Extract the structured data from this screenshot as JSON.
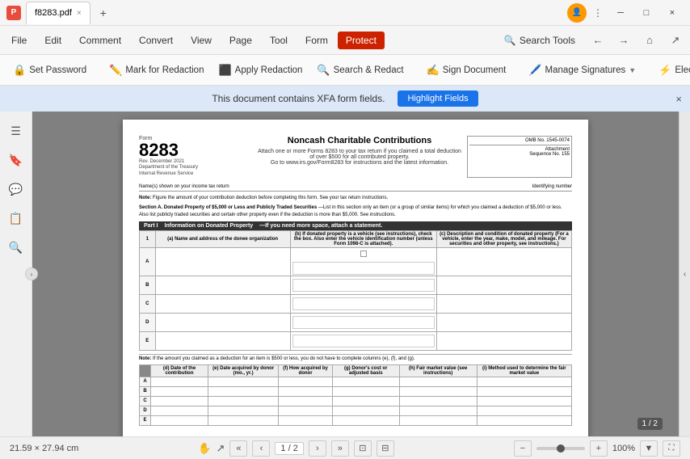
{
  "titlebar": {
    "app_icon": "P",
    "tab_filename": "f8283.pdf",
    "tab_close": "×",
    "tab_add": "+",
    "profile_icon": "👤",
    "window_min": "─",
    "window_max": "□",
    "window_close": "×"
  },
  "menubar": {
    "items": [
      "File",
      "Edit",
      "Comment",
      "Convert",
      "View",
      "Page",
      "Tool",
      "Form",
      "Protect"
    ],
    "active": "Protect",
    "search_tools": "Search Tools",
    "nav_back": "←",
    "nav_forward": "→",
    "nav_home": "⌂",
    "nav_share": "↗"
  },
  "toolbar": {
    "set_password": "Set Password",
    "mark_for_redaction": "Mark for Redaction",
    "apply_redaction": "Apply Redaction",
    "search_redact": "Search & Redact",
    "sign_document": "Sign Document",
    "manage_signatures": "Manage Signatures",
    "electroredact": "Electro..."
  },
  "banner": {
    "message": "This document contains XFA form fields.",
    "highlight_btn": "Highlight Fields",
    "close": "×"
  },
  "sidebar": {
    "icons": [
      "☰",
      "🔖",
      "💬",
      "📋",
      "🔍"
    ]
  },
  "pdf": {
    "form_number": "8283",
    "form_rev": "Rev. December 2021",
    "form_dept": "Department of the Treasury\nInternal Revenue Service",
    "form_title": "Noncash Charitable Contributions",
    "form_subtitle1": "Attach one or more Forms 8283 to your tax return if you claimed a total deduction",
    "form_subtitle2": "of over $500 for all contributed property.",
    "form_subtitle3": "Go to www.irs.gov/Form8283 for instructions and the latest information.",
    "omb": "OMB No. 1545-0074",
    "attachment_no": "Attachment\nSequence No. 155",
    "name_label": "Name(s) shown on your income tax return",
    "identifying_label": "Identifying number",
    "note1": "Note: Figure the amount of your contribution deduction before completing this form. See your tax return instructions.",
    "section_a_title": "Section A. Donated Property of $5,000 or Less and Publicly Traded Securities",
    "section_a_desc": "—List in this section only an item (or a group of similar items) for which you claimed a deduction of $5,000 or less. Also list publicly traded securities and certain other property even if the deduction is more than $5,000. See instructions.",
    "part_i_label": "Part I",
    "part_i_title": "Information on Donated Property",
    "part_i_note": "—If you need more space, attach a statement.",
    "col1_label": "1",
    "col_a": "(a) Name and address of the\ndonee organization",
    "col_b": "(b) If donated property is a vehicle (see instructions), check the box.\nAlso enter the vehicle identification number (unless Form 1098-C is\nattached).",
    "col_c": "(c) Description and condition of donated property\n(For a vehicle, enter the year, make, model, and mileage. For\nsecurities and other property,\nsee instructions.)",
    "rows": [
      "A",
      "B",
      "C",
      "D",
      "E"
    ],
    "bottom_note": "Note: If the amount you claimed as a deduction for an item is $500 or less, you do not have to complete columns (e), (f), and (g).",
    "col_d": "(d) Date of the\ncontribution",
    "col_e": "(e) Date acquired\nby donor (mo., yr.)",
    "col_f": "(f) How acquired\nby donor",
    "col_g": "(g) Donor's cost\nor adjusted basis",
    "col_h": "(h) Fair market value\n(see instructions)",
    "col_i": "(i) Method used to determine\nthe fair market value",
    "rows2": [
      "A",
      "B",
      "C",
      "D",
      "E"
    ]
  },
  "statusbar": {
    "dimensions": "21.59 × 27.94 cm",
    "page_current": "1 / 2",
    "nav_prev_prev": "«",
    "nav_prev": "‹",
    "nav_next": "›",
    "nav_next_next": "»",
    "fit_page": "⊡",
    "fit_width": "⊟",
    "zoom_out": "−",
    "zoom_in": "+",
    "zoom_level": "100%",
    "page_badge": "1 / 2"
  }
}
